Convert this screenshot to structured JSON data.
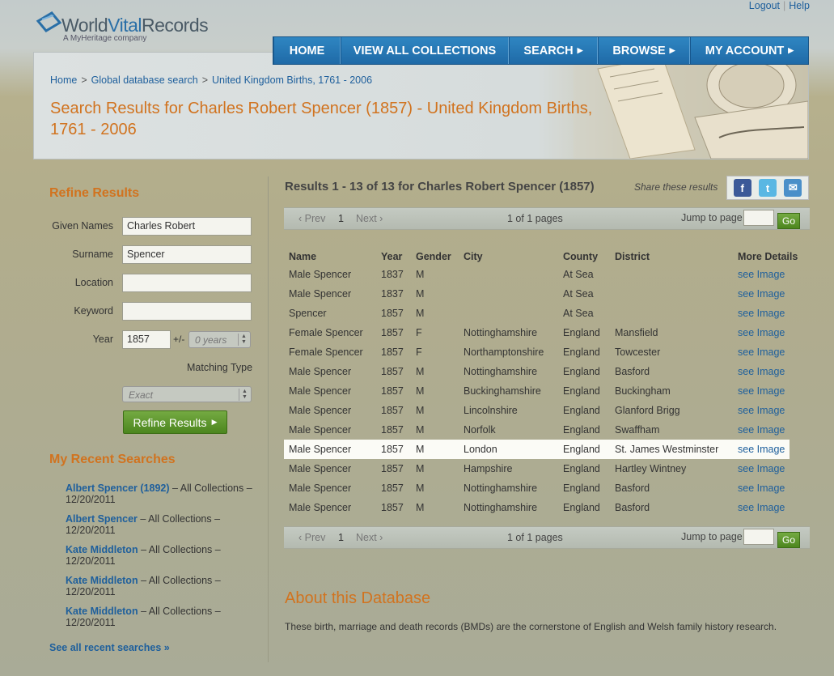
{
  "header": {
    "logo_main": "World",
    "logo_accent": "Vital",
    "logo_tail": "Records",
    "logo_sub": "A MyHeritage company",
    "logout": "Logout",
    "help": "Help",
    "sep": "|"
  },
  "nav": [
    {
      "label": "HOME",
      "arrow": ""
    },
    {
      "label": "VIEW ALL COLLECTIONS",
      "arrow": ""
    },
    {
      "label": "SEARCH",
      "arrow": "▶"
    },
    {
      "label": "BROWSE",
      "arrow": "▶"
    },
    {
      "label": "MY ACCOUNT",
      "arrow": "▶"
    }
  ],
  "breadcrumb": {
    "home": "Home",
    "global": "Global database search",
    "current": "United Kingdom Births, 1761 - 2006",
    "sep": ">"
  },
  "page_title": "Search Results for Charles Robert Spencer (1857) - United Kingdom Births, 1761 - 2006",
  "refine": {
    "title": "Refine Results",
    "given_names_label": "Given Names",
    "given_names_value": "Charles Robert",
    "surname_label": "Surname",
    "surname_value": "Spencer",
    "location_label": "Location",
    "location_value": "",
    "keyword_label": "Keyword",
    "keyword_value": "",
    "year_label": "Year",
    "year_value": "1857",
    "plusminus": "+/-",
    "range_value": "0 years",
    "matching_label": "Matching Type",
    "matching_value": "Exact",
    "button": "Refine Results",
    "button_arrow": "▶"
  },
  "recent": {
    "title": "My Recent Searches",
    "items": [
      {
        "name": "Albert Spencer (1892)",
        "rest": " – All Collections –",
        "date": "12/20/2011"
      },
      {
        "name": "Albert Spencer",
        "rest": " – All Collections –",
        "date": "12/20/2011"
      },
      {
        "name": "Kate Middleton",
        "rest": " – All Collections –",
        "date": "12/20/2011"
      },
      {
        "name": "Kate Middleton",
        "rest": " – All Collections –",
        "date": "12/20/2011"
      },
      {
        "name": "Kate Middleton",
        "rest": " – All Collections –",
        "date": "12/20/2011"
      }
    ],
    "see_all": "See all recent searches »"
  },
  "results": {
    "title": "Results 1 - 13 of 13 for Charles Robert Spencer (1857)",
    "share_label": "Share these results",
    "pager": {
      "prev": "‹ Prev",
      "page": "1",
      "next": "Next ›",
      "pages": "1 of 1 pages",
      "jump": "Jump to page",
      "go": "Go"
    },
    "columns": [
      "Name",
      "Year",
      "Gender",
      "City",
      "County",
      "District",
      "More Details"
    ],
    "rows": [
      [
        "Male Spencer",
        "1837",
        "M",
        "",
        "At Sea",
        "",
        "see Image"
      ],
      [
        "Male Spencer",
        "1837",
        "M",
        "",
        "At Sea",
        "",
        "see Image"
      ],
      [
        "Spencer",
        "1857",
        "M",
        "",
        "At Sea",
        "",
        "see Image"
      ],
      [
        "Female Spencer",
        "1857",
        "F",
        "Nottinghamshire",
        "England",
        "Mansfield",
        "see Image"
      ],
      [
        "Female Spencer",
        "1857",
        "F",
        "Northamptonshire",
        "England",
        "Towcester",
        "see Image"
      ],
      [
        "Male Spencer",
        "1857",
        "M",
        "Nottinghamshire",
        "England",
        "Basford",
        "see Image"
      ],
      [
        "Male Spencer",
        "1857",
        "M",
        "Buckinghamshire",
        "England",
        "Buckingham",
        "see Image"
      ],
      [
        "Male Spencer",
        "1857",
        "M",
        "Lincolnshire",
        "England",
        "Glanford Brigg",
        "see Image"
      ],
      [
        "Male Spencer",
        "1857",
        "M",
        "Norfolk",
        "England",
        "Swaffham",
        "see Image"
      ],
      [
        "Male Spencer",
        "1857",
        "M",
        "London",
        "England",
        "St. James Westminster",
        "see Image"
      ],
      [
        "Male Spencer",
        "1857",
        "M",
        "Hampshire",
        "England",
        "Hartley Wintney",
        "see Image"
      ],
      [
        "Male Spencer",
        "1857",
        "M",
        "Nottinghamshire",
        "England",
        "Basford",
        "see Image"
      ],
      [
        "Male Spencer",
        "1857",
        "M",
        "Nottinghamshire",
        "England",
        "Basford",
        "see Image"
      ]
    ],
    "highlighted_row": 9
  },
  "about": {
    "title": "About this Database",
    "text": "These birth, marriage and death records (BMDs) are the cornerstone of English and Welsh family history research."
  },
  "colors": {
    "accent_orange": "#d1731f",
    "link_blue": "#1e5f9c",
    "nav_blue": "#2478b5",
    "button_green": "#5e9a2e"
  }
}
